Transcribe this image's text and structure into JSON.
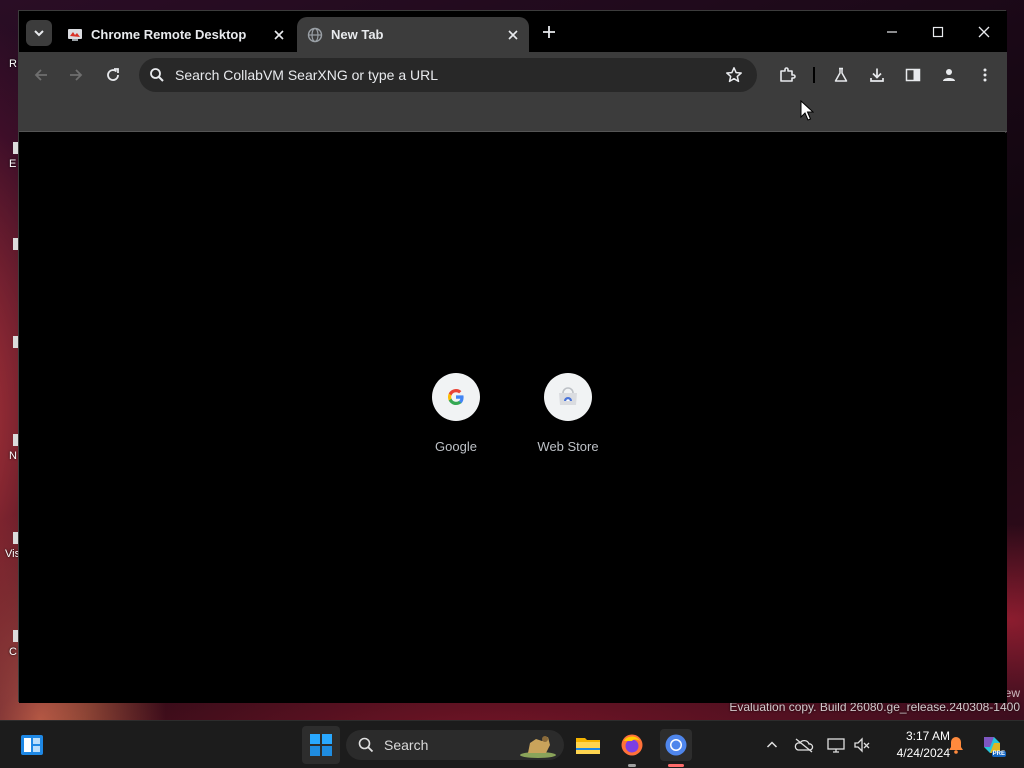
{
  "browser": {
    "tabs": [
      {
        "title": "Chrome Remote Desktop",
        "active": false
      },
      {
        "title": "New Tab",
        "active": true
      }
    ],
    "omnibox": {
      "placeholder": "Search CollabVM SearXNG or type a URL"
    },
    "toolbar_icons": [
      "back-icon",
      "forward-icon",
      "reload-icon",
      "bookmark-star-icon",
      "extensions-icon",
      "labs-flask-icon",
      "download-icon",
      "side-panel-icon",
      "profile-icon",
      "menu-kebab-icon"
    ],
    "shortcuts": [
      {
        "label": "Google",
        "icon": "google-g-icon"
      },
      {
        "label": "Web Store",
        "icon": "chrome-web-store-icon"
      }
    ],
    "theme": {
      "tabstrip": "#000000",
      "toolbar": "#3c3c3c",
      "omnibox": "#282828",
      "content": "#000000"
    }
  },
  "desktop": {
    "watermark": "Evaluation copy. Build 26080.ge_release.240308-1400",
    "watermark_fragment": "ew",
    "icon_fragments": [
      "R",
      "E",
      "",
      "",
      "N",
      "Vis",
      "C"
    ]
  },
  "taskbar": {
    "search_label": "Search",
    "clock_time": "3:17 AM",
    "clock_date": "4/24/2024",
    "apps": [
      "widgets-icon",
      "start-icon",
      "file-explorer-icon",
      "firefox-icon",
      "chrome-icon"
    ],
    "tray_icons": [
      "chevron-up-icon",
      "onedrive-offline-icon",
      "display-icon",
      "network-volume-icon",
      "notification-bell-icon",
      "copilot-icon"
    ],
    "tray_badge": "PRE"
  }
}
